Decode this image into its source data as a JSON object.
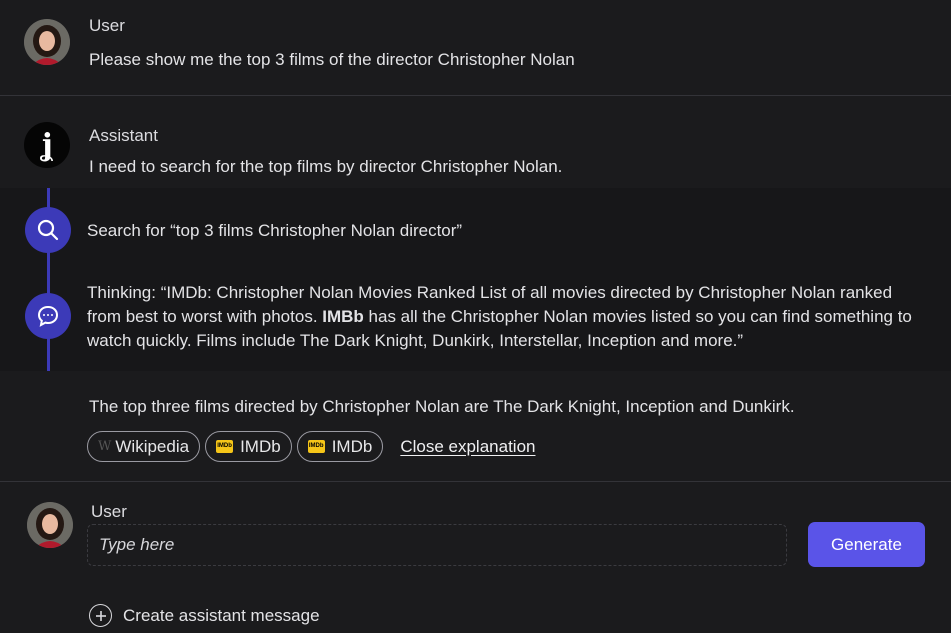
{
  "messages": {
    "first_user": {
      "role": "User",
      "text": "Please show me the top 3 films of the director Christopher Nolan"
    },
    "assistant": {
      "role": "Assistant",
      "intro": "I need to search for the top films by director Christopher Nolan.",
      "steps": [
        {
          "icon": "search-icon",
          "text": "Search for “top 3 films Christopher Nolan director”"
        },
        {
          "icon": "chat-bubble-icon",
          "text_before": "Thinking: “IMDb: Christopher Nolan Movies Ranked List of all movies directed by Christopher Nolan ranked from best to worst with photos. ",
          "text_bold": "IMBb",
          "text_after": " has all the Christopher Nolan movies listed so you can find something to watch quickly. Films include The Dark Knight, Dunkirk, Interstellar, Inception and more.”"
        }
      ],
      "answer": "The top three films directed by Christopher Nolan are The Dark Knight, Inception and Dunkirk.",
      "sources": [
        {
          "label": "Wikipedia",
          "icon": "wikipedia-icon"
        },
        {
          "label": "IMDb",
          "icon": "imdb-icon"
        },
        {
          "label": "IMDb",
          "icon": "imdb-icon"
        }
      ],
      "close_label": "Close explanation"
    },
    "composer": {
      "role": "User",
      "placeholder": "Type here",
      "generate_label": "Generate",
      "add_label": "Create assistant message"
    }
  },
  "colors": {
    "background": "#1b1b1d",
    "accent": "#5a54e8",
    "timeline": "#3c3ab8",
    "imdb_yellow": "#f5c518"
  }
}
